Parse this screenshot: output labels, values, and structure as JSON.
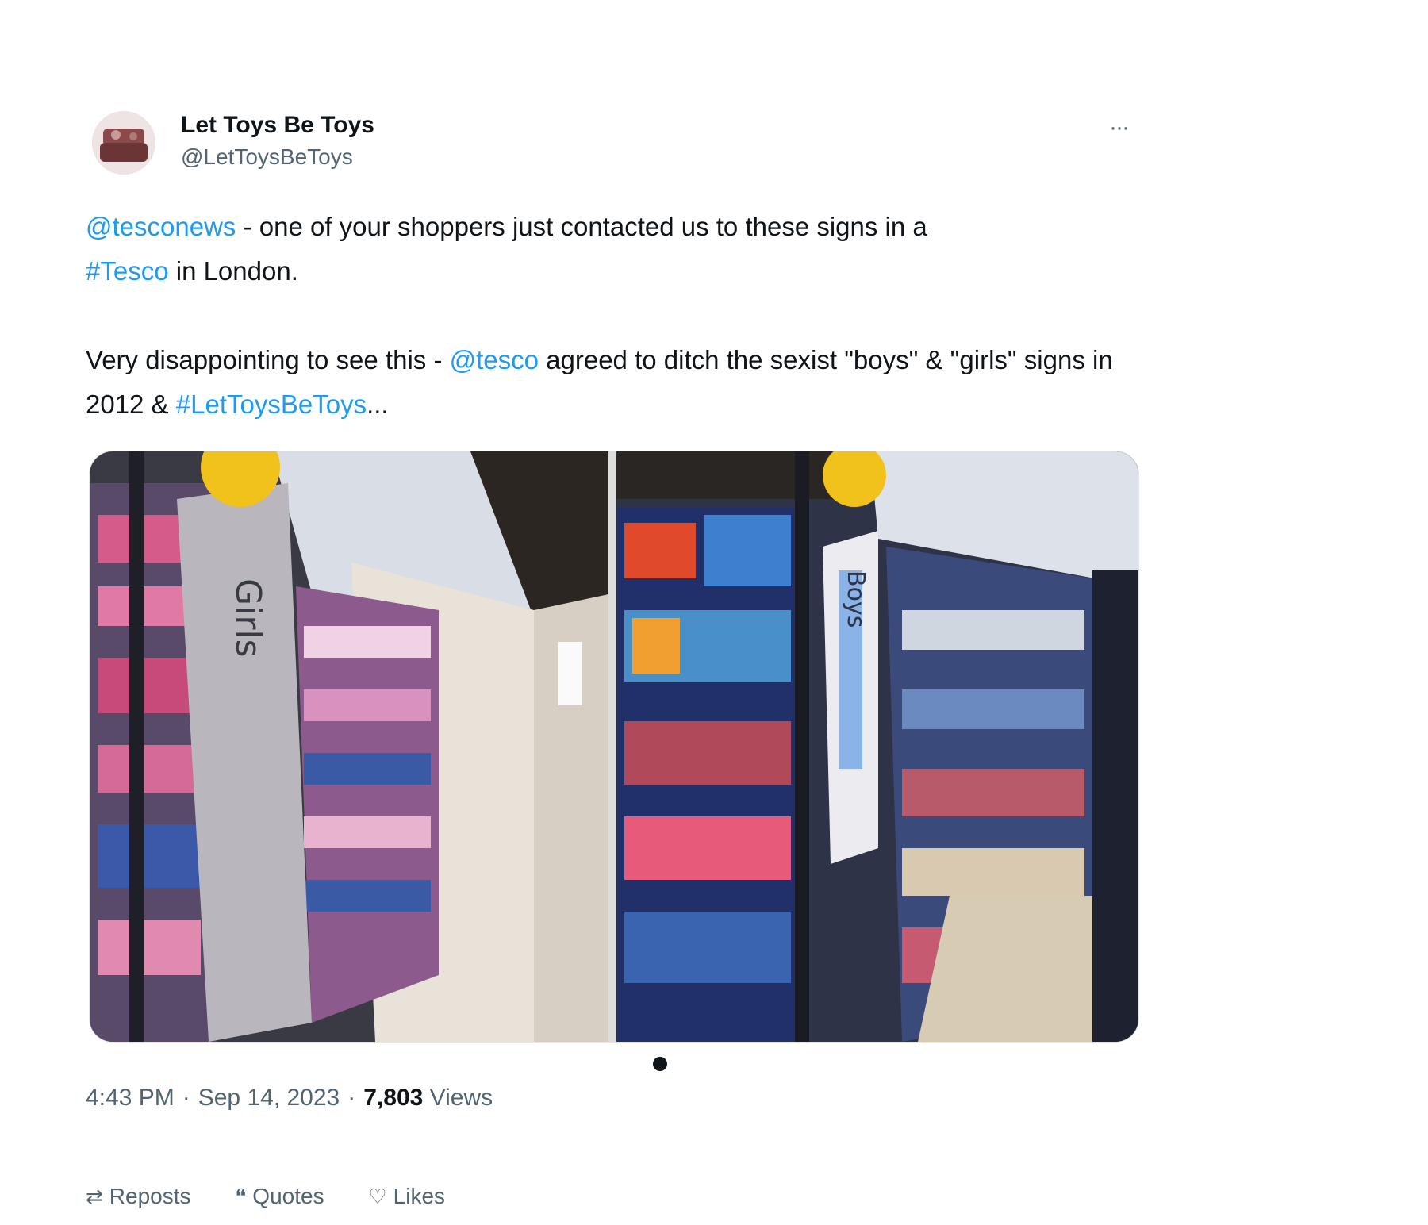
{
  "tweet": {
    "author": {
      "display_name": "Let Toys Be Toys",
      "handle": "@LetToysBeToys"
    },
    "more_icon": "ellipsis-icon",
    "mentions": {
      "first": "@tesconews"
    },
    "text_line1_rest": " - one of your shoppers just contacted us to these signs in a",
    "hashtag_store": "#Tesco",
    "text_line2_rest": " in London.",
    "para2_start": "Very disappointing to see this - ",
    "mention_2": "@tesco",
    "para2_mid": " agreed to ditch the sexist \"boys\" & \"girls\" signs in 2012 &",
    "hashtag_2": "#LetToysBeToys",
    "ellipsis": "...",
    "media": {
      "left_photo_sign": "Girls",
      "right_photo_sign": "Boys"
    },
    "meta": {
      "time": "4:43 PM",
      "date": "Sep 14, 2023",
      "views_count": "7,803",
      "views_label": "Views",
      "sep": "·"
    },
    "actions": {
      "reposts": "Reposts",
      "quotes": "Quotes",
      "likes": "Likes"
    }
  },
  "colors": {
    "link": "#1d9bf0",
    "text": "#0f1419",
    "secondary": "#536471"
  }
}
